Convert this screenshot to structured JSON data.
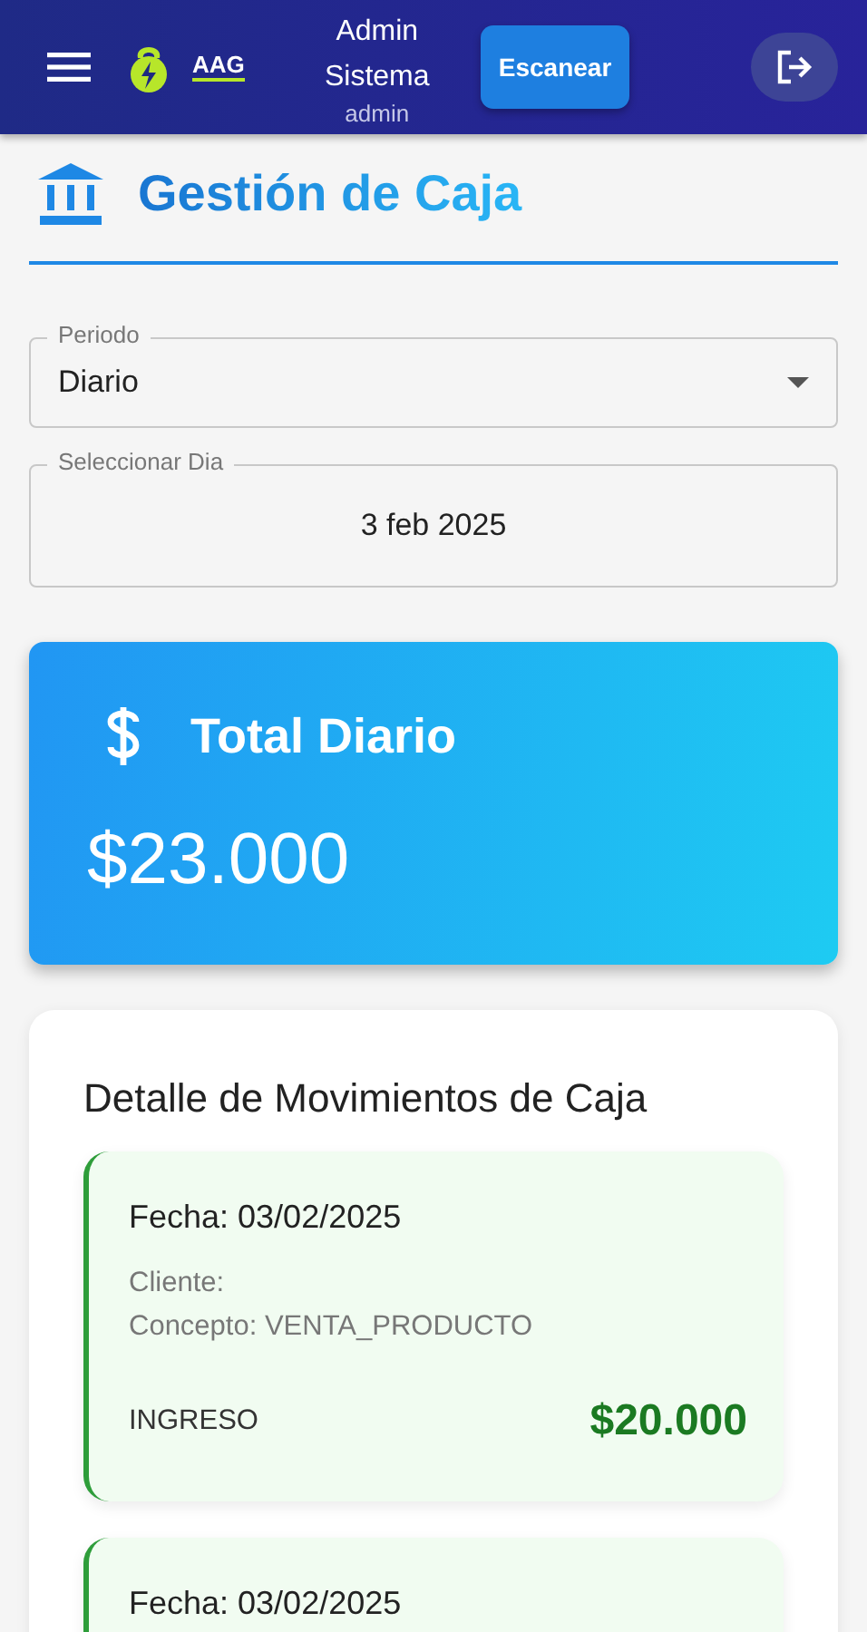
{
  "header": {
    "brand": "AAG",
    "user_name": "Admin Sistema",
    "username": "admin",
    "scan_button": "Escanear"
  },
  "page_title": "Gestión de Caja",
  "period_field": {
    "label": "Periodo",
    "value": "Diario"
  },
  "day_field": {
    "label": "Seleccionar Dia",
    "value": "3 feb 2025"
  },
  "total_card": {
    "title": "Total Diario",
    "amount": "$23.000"
  },
  "movements": {
    "title": "Detalle de Movimientos de Caja",
    "items": [
      {
        "kind": "income",
        "date": "Fecha: 03/02/2025",
        "client": "Cliente:",
        "concept": "Concepto: VENTA_PRODUCTO",
        "type": "INGRESO",
        "amount": "$20.000"
      },
      {
        "kind": "income",
        "date": "Fecha: 03/02/2025"
      }
    ]
  }
}
